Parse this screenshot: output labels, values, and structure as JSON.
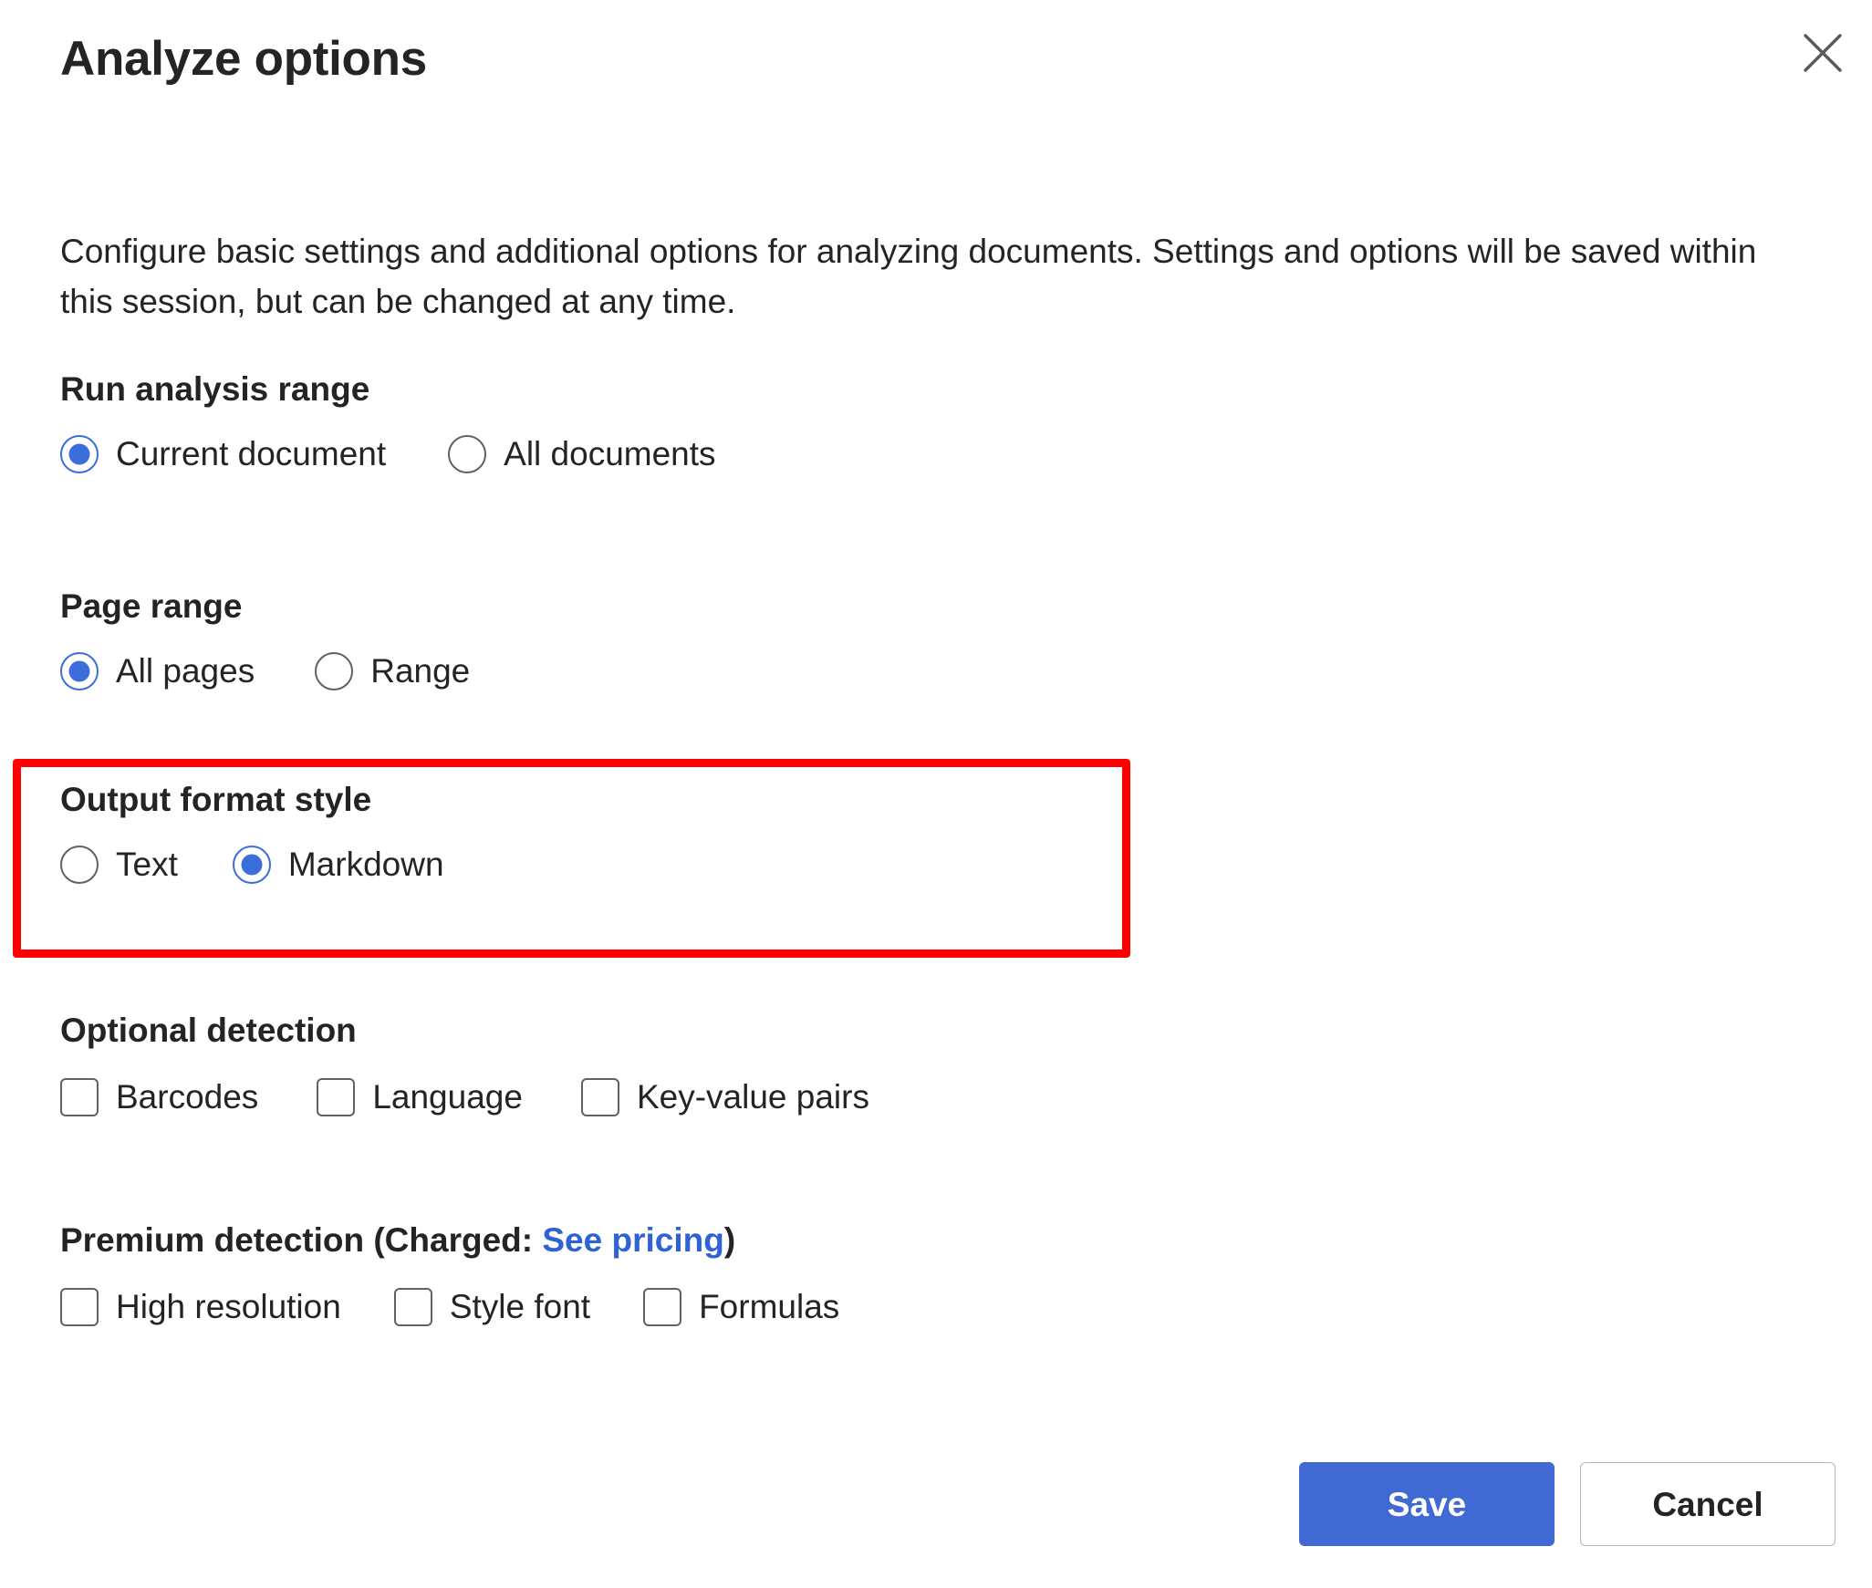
{
  "dialog": {
    "title": "Analyze options",
    "close_icon": "close-icon",
    "description": "Configure basic settings and additional options for analyzing documents. Settings and options will be saved within this session, but can be changed at any time."
  },
  "sections": {
    "run_analysis_range": {
      "label": "Run analysis range",
      "options": [
        {
          "label": "Current document",
          "selected": true
        },
        {
          "label": "All documents",
          "selected": false
        }
      ]
    },
    "page_range": {
      "label": "Page range",
      "options": [
        {
          "label": "All pages",
          "selected": true
        },
        {
          "label": "Range",
          "selected": false
        }
      ]
    },
    "output_format_style": {
      "label": "Output format style",
      "highlighted": true,
      "highlight_color": "#ff0000",
      "options": [
        {
          "label": "Text",
          "selected": false
        },
        {
          "label": "Markdown",
          "selected": true
        }
      ]
    },
    "optional_detection": {
      "label": "Optional detection",
      "options": [
        {
          "label": "Barcodes",
          "checked": false
        },
        {
          "label": "Language",
          "checked": false
        },
        {
          "label": "Key-value pairs",
          "checked": false
        }
      ]
    },
    "premium_detection": {
      "label_prefix": "Premium detection (Charged: ",
      "link_text": "See pricing",
      "label_suffix": ")",
      "options": [
        {
          "label": "High resolution",
          "checked": false
        },
        {
          "label": "Style font",
          "checked": false
        },
        {
          "label": "Formulas",
          "checked": false
        }
      ]
    }
  },
  "footer": {
    "save_label": "Save",
    "cancel_label": "Cancel"
  },
  "colors": {
    "accent": "#4169d4",
    "radio_selected": "#3b6ddb",
    "link": "#2f62d4",
    "highlight": "#ff0000",
    "text": "#242424"
  }
}
